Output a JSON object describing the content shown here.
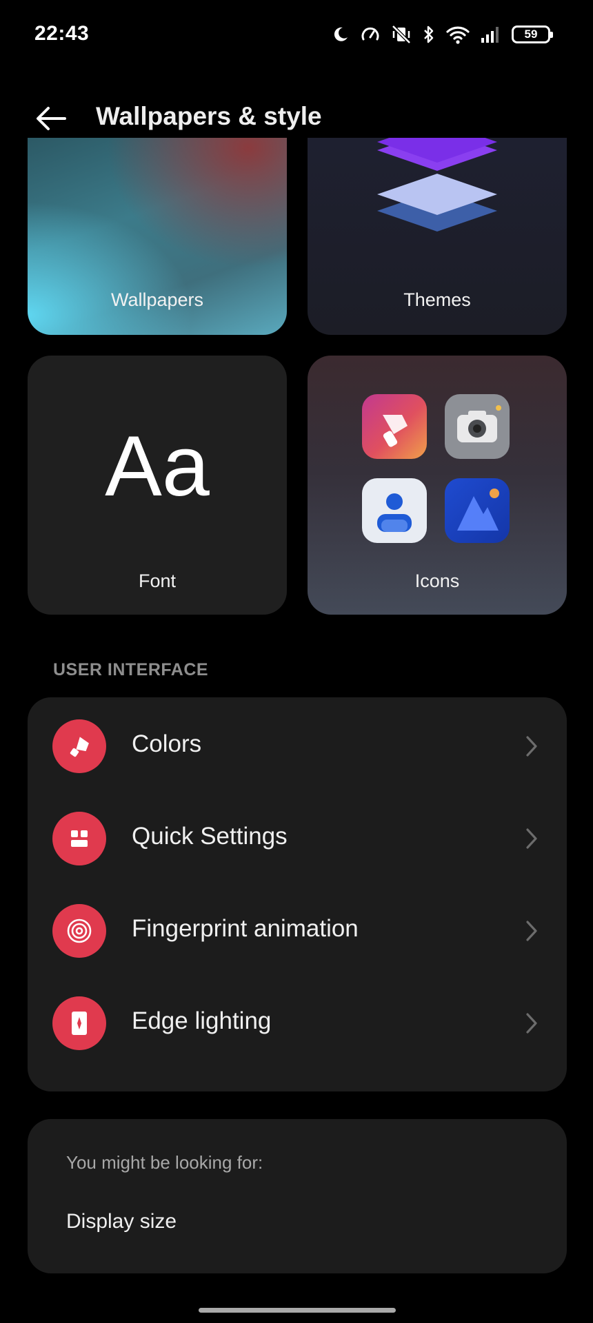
{
  "status_bar": {
    "time": "22:43",
    "battery": "59",
    "icons": [
      "moon-icon",
      "speed-icon",
      "vibrate-off-icon",
      "bluetooth-icon",
      "wifi-icon",
      "signal-icon",
      "battery-icon"
    ]
  },
  "header": {
    "title": "Wallpapers & style",
    "back_icon": "back-arrow-icon"
  },
  "tiles": [
    {
      "label": "Wallpapers"
    },
    {
      "label": "Themes"
    },
    {
      "label": "Font",
      "sample": "Aa"
    },
    {
      "label": "Icons"
    }
  ],
  "user_interface": {
    "section_title": "USER INTERFACE",
    "items": [
      {
        "label": "Colors",
        "icon": "brush-icon"
      },
      {
        "label": "Quick Settings",
        "icon": "quick-settings-icon"
      },
      {
        "label": "Fingerprint animation",
        "icon": "fingerprint-icon"
      },
      {
        "label": "Edge lighting",
        "icon": "edge-lighting-icon"
      }
    ],
    "accent_color": "#e03a4e"
  },
  "suggestions": {
    "caption": "You might be looking for:",
    "items": [
      "Display size"
    ]
  }
}
